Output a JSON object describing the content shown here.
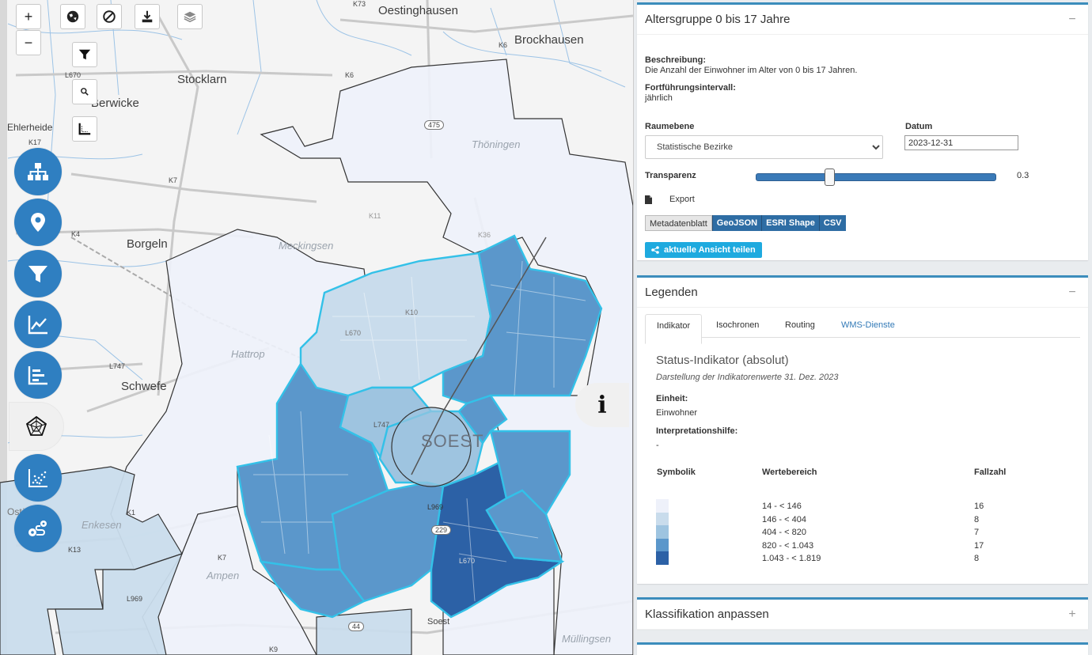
{
  "map": {
    "place_labels": [
      "Oestinghausen",
      "Brockhausen",
      "Stocklarn",
      "Berwicke",
      "Ehlerheide",
      "Thöningen",
      "Borgeln",
      "Meckingsen",
      "Hattrop",
      "Schwefe",
      "Enkesen",
      "Ampen",
      "Müllingsen",
      "Soest",
      "SOEST",
      "Ostönnen"
    ],
    "road_labels": [
      "K73",
      "K6",
      "L670",
      "K6",
      "K17",
      "K7",
      "K4",
      "K11",
      "K36",
      "K10",
      "L670",
      "L747",
      "L747",
      "K1",
      "K13",
      "K7",
      "L969",
      "L969",
      "L670",
      "K9",
      "475",
      "229",
      "44"
    ],
    "colors": {
      "class1": "#eef1fa",
      "class2": "#c9dcec",
      "class3": "#9ec4e0",
      "class4": "#5b97cb",
      "class5": "#2c61a6",
      "highlight": "#33c1e8"
    },
    "zoom_in": "+",
    "zoom_out": "−",
    "sidebar_buttons": [
      "hierarchy-icon",
      "map-pin-icon",
      "filter-icon",
      "line-chart-icon",
      "bar-chart-icon",
      "radar-chart-icon",
      "scatter-plot-icon",
      "route-icon"
    ],
    "info": "i"
  },
  "indicator": {
    "title": "Altersgruppe 0 bis 17 Jahre",
    "collapse": "−",
    "desc_label": "Beschreibung:",
    "desc_text": "Die Anzahl der Einwohner im Alter von 0 bis 17 Jahren.",
    "interval_label": "Fortführungsintervall:",
    "interval_text": "jährlich",
    "raumebene_label": "Raumebene",
    "raumebene_value": "Statistische Bezirke",
    "datum_label": "Datum",
    "datum_value": "2023-12-31",
    "transparenz_label": "Transparenz",
    "transparenz_value": "0.3",
    "export_label": "Export",
    "btn_metadaten": "Metadatenblatt",
    "btn_geojson": "GeoJSON",
    "btn_esri": "ESRI Shape",
    "btn_csv": "CSV",
    "share_label": "aktuelle Ansicht teilen"
  },
  "legend": {
    "title": "Legenden",
    "collapse": "−",
    "tabs": [
      "Indikator",
      "Isochronen",
      "Routing",
      "WMS-Dienste"
    ],
    "status_title": "Status-Indikator (absolut)",
    "status_sub": "Darstellung der Indikatorenwerte 31. Dez. 2023",
    "einheit_label": "Einheit:",
    "einheit_value": "Einwohner",
    "interp_label": "Interpretationshilfe:",
    "interp_value": "-",
    "col_symbolik": "Symbolik",
    "col_werte": "Wertebereich",
    "col_fall": "Fallzahl",
    "rows": [
      {
        "range": "14 - < 146",
        "count": "16",
        "color": "#eef1fa"
      },
      {
        "range": "146 - < 404",
        "count": "8",
        "color": "#c9dcec"
      },
      {
        "range": "404 - < 820",
        "count": "7",
        "color": "#9ec4e0"
      },
      {
        "range": "820 - < 1.043",
        "count": "17",
        "color": "#5b97cb"
      },
      {
        "range": "1.043 - < 1.819",
        "count": "8",
        "color": "#2c61a6"
      }
    ]
  },
  "klassifikation": {
    "title": "Klassifikation anpassen",
    "expand": "+"
  }
}
